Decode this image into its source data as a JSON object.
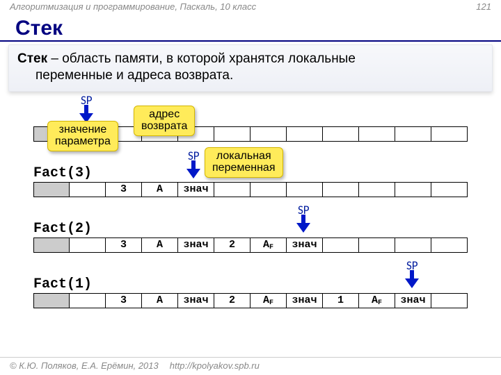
{
  "header": {
    "left": "Алгоритмизация и программирование, Паскаль, 10 класс",
    "page": "121"
  },
  "title": "Стек",
  "definition": {
    "kw": "Стек",
    "dash": " – ",
    "line1_rest": "область памяти, в которой хранятся локальные",
    "line2": "переменные и адреса возврата."
  },
  "sp_label": "SP",
  "callouts": {
    "param": "значение\nпараметра",
    "retaddr": "адрес\nвозврата",
    "localvar": "локальная\nпеременная"
  },
  "calls": {
    "f3": "Fact(3)",
    "f2": "Fact(2)",
    "f1": "Fact(1)"
  },
  "cells": {
    "c3": "3",
    "A": "A",
    "AF": "A",
    "AFsub": "F",
    "znach": "знач",
    "c2": "2",
    "c1": "1"
  },
  "footer": {
    "copy": "© К.Ю. Поляков, Е.А. Ерёмин, 2013",
    "url": "http://kpolyakov.spb.ru"
  }
}
